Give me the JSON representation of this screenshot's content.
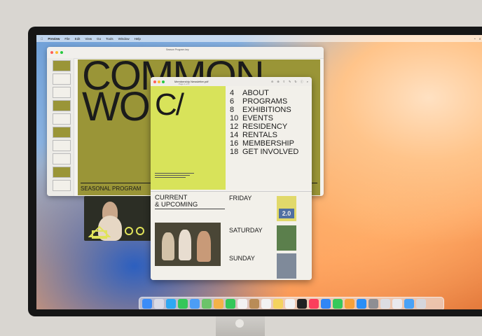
{
  "menubar": {
    "app": "Preview",
    "items": [
      "File",
      "Edit",
      "View",
      "Go",
      "Tools",
      "Window",
      "Help"
    ],
    "status_icons": [
      "wifi-icon",
      "search-icon",
      "control-center-icon"
    ]
  },
  "back_window": {
    "title": "Season Program.key",
    "big_title_line1": "COMMON",
    "big_title_line2": "WO",
    "footer": "SEASONAL PROGRAM"
  },
  "front_window": {
    "title": "Membership Newsletter.pdf",
    "subtitle": "Page 1 of 3",
    "cover_letters": "C/",
    "toc": [
      {
        "num": "4",
        "label": "ABOUT"
      },
      {
        "num": "6",
        "label": "PROGRAMS"
      },
      {
        "num": "8",
        "label": "EXHIBITIONS"
      },
      {
        "num": "10",
        "label": "EVENTS"
      },
      {
        "num": "12",
        "label": "RESIDENCY"
      },
      {
        "num": "14",
        "label": "RENTALS"
      },
      {
        "num": "16",
        "label": "MEMBERSHIP"
      },
      {
        "num": "18",
        "label": "GET INVOLVED"
      }
    ],
    "current_line1": "CURRENT",
    "current_line2": "& UPCOMING",
    "days": [
      "FRIDAY",
      "SATURDAY",
      "SUNDAY"
    ],
    "poster_text": "2.0"
  },
  "colors": {
    "olive": "#9a9537",
    "lime": "#d8e35a"
  }
}
